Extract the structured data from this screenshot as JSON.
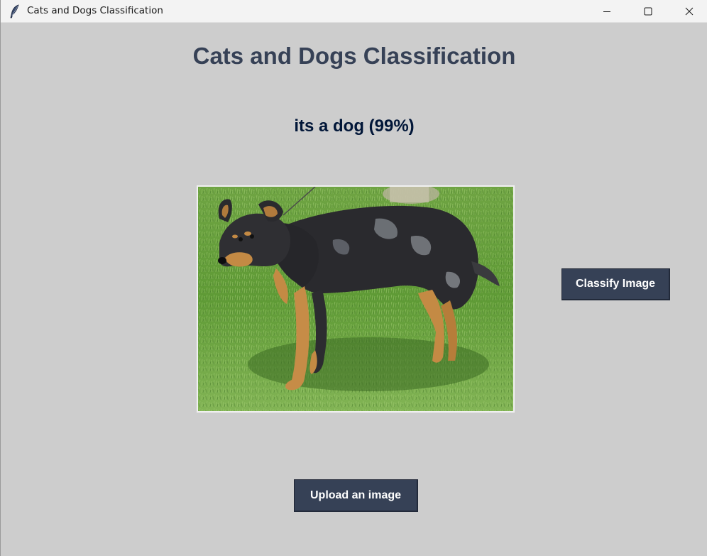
{
  "window": {
    "title": "Cats and Dogs Classification",
    "controls": [
      "minimize-icon",
      "maximize-icon",
      "close-icon"
    ]
  },
  "main": {
    "heading": "Cats and Dogs Classification",
    "result": "its a dog (99%)",
    "image": {
      "subject": "dog standing on grass"
    },
    "classify_button": "Classify Image",
    "upload_button": "Upload an image"
  },
  "colors": {
    "background": "#cdcdcd",
    "heading": "#364156",
    "result": "#011638",
    "button_bg": "#364156",
    "button_text": "#ffffff"
  }
}
